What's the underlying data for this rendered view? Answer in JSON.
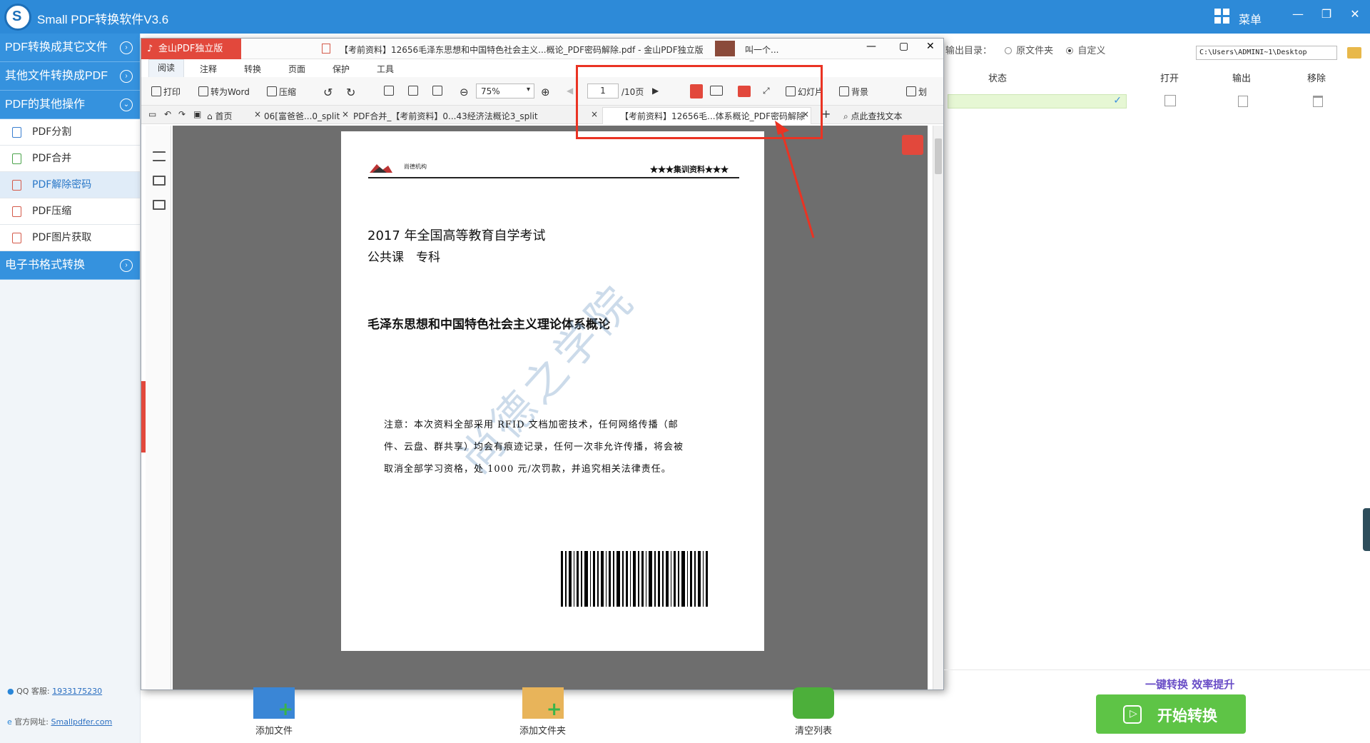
{
  "app": {
    "title": "Small PDF转换软件V3.6",
    "menu_label": "菜单"
  },
  "sidebar": {
    "categories": [
      {
        "label": "PDF转换成其它文件"
      },
      {
        "label": "其他文件转换成PDF"
      },
      {
        "label": "PDF的其他操作"
      },
      {
        "label": "电子书格式转换"
      }
    ],
    "items": [
      {
        "label": "PDF分割"
      },
      {
        "label": "PDF合并"
      },
      {
        "label": "PDF解除密码"
      },
      {
        "label": "PDF压缩"
      },
      {
        "label": "PDF图片获取"
      }
    ],
    "qq_label": "QQ 客服:",
    "qq_value": "1933175230",
    "site_label": "官方网址:",
    "site_value": "Smallpdfer.com"
  },
  "output": {
    "label": "输出目录：",
    "option_original": "原文件夹",
    "option_custom": "自定义",
    "path": "C:\\Users\\ADMINI~1\\Desktop"
  },
  "table": {
    "headers": [
      "状态",
      "打开",
      "输出",
      "移除"
    ]
  },
  "pdf_window": {
    "badge": "金山PDF独立版",
    "title": "【考前资料】12656毛泽东思想和中国特色社会主义...概论_PDF密码解除.pdf - 金山PDF独立版",
    "extra_title": "叫一个...",
    "menu_tabs": [
      "阅读",
      "注释",
      "转换",
      "页面",
      "保护",
      "工具"
    ],
    "toolbar": {
      "print": "打印",
      "to_word": "转为Word",
      "compress": "压缩",
      "zoom": "75%",
      "page_current": "1",
      "page_total": "/10页",
      "slideshow": "幻灯片",
      "background": "背景",
      "translate": "划"
    },
    "doc_tabs": [
      "首页",
      "06[富爸爸...0_split",
      "PDF合并_【考前资料】0...43经济法概论3_split",
      "【考前资料】12656毛...体系概论_PDF密码解除"
    ],
    "search_label": "点此查找文本"
  },
  "document": {
    "org_name": "尚德机构",
    "header_right": "★★★集训资料★★★",
    "line1": "2017 年全国高等教育自学考试",
    "line2": "公共课　专科",
    "title": "毛泽东思想和中国特色社会主义理论体系概论",
    "notice": "注意：本次资料全部采用 RFID 文档加密技术，任何网络传播（邮件、云盘、群共享）均会有痕迹记录，任何一次非允许传播，将会被取消全部学习资格，处 1000 元/次罚款，并追究相关法律责任。",
    "watermark": "尚德之学院"
  },
  "bottom": {
    "add_file": "添加文件",
    "add_folder": "添加文件夹",
    "clear_list": "清空列表",
    "slogan": "一键转换  效率提升",
    "start": "开始转换"
  },
  "colors": {
    "title_bar": "#2d8ad8",
    "accent_red": "#ea3323",
    "start_green": "#5ec446"
  }
}
